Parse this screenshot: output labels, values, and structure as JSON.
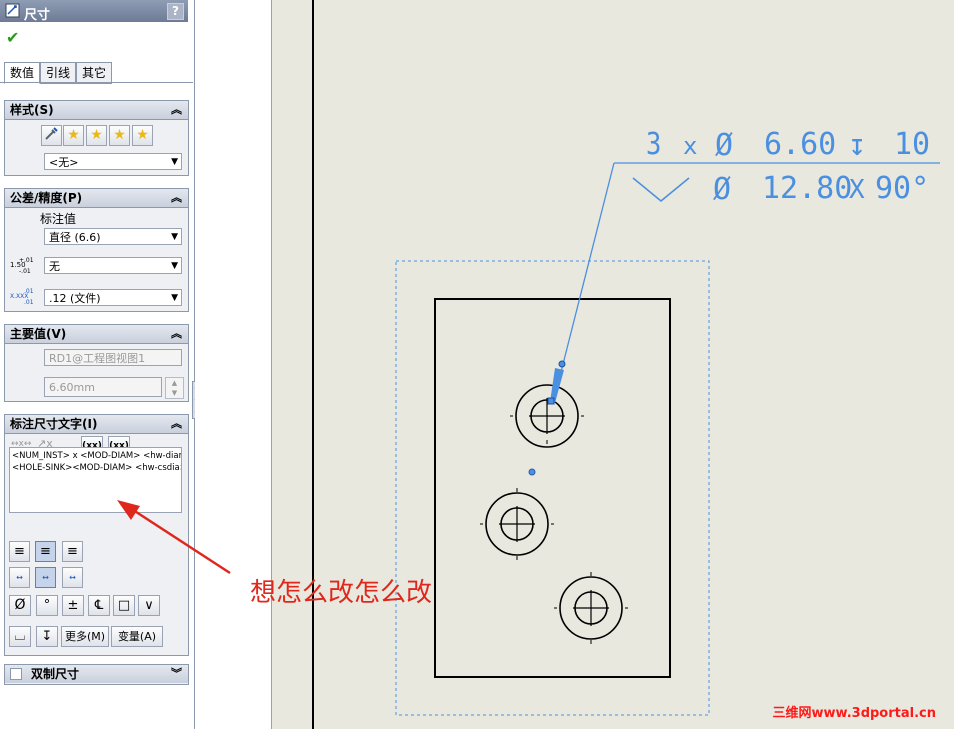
{
  "panel": {
    "title": "尺寸",
    "help": "?",
    "ok_icon": "checkmark-icon",
    "tabs": [
      "数值",
      "引线",
      "其它"
    ]
  },
  "style_group": {
    "header": "样式(S)",
    "combo_value": "<无>"
  },
  "tolerance_group": {
    "header": "公差/精度(P)",
    "label": "标注值",
    "combo1": "直径 (6.6)",
    "combo2": "无",
    "combo3": ".12 (文件)",
    "tol_icon_main": "1.50",
    "tol_icon_sup": "+.01",
    "tol_icon_sub": "-.01",
    "prec_icon_main": "X.XXX",
    "prec_icon_sup": ".01",
    "prec_icon_sub": ".01"
  },
  "primary_group": {
    "header": "主要值(V)",
    "ref_field": "RD1@工程图视图1",
    "value_field": "6.60mm"
  },
  "dimtext_group": {
    "header": "标注尺寸文字(I)",
    "paren_btn1": "(xx)",
    "paren_btn2": "(xx)",
    "line1": "<NUM_INST> x <MOD-DIAM> <hw-diam> <HOLE-DEPTH> <hw-depth>",
    "line2": "<HOLE-SINK><MOD-DIAM> <hw-csdia> X <hw-csangle>",
    "sym_diam": "Ø",
    "sym_deg": "°",
    "sym_pm": "±",
    "sym_cl": "℄",
    "sym_sq": "□",
    "sym_csk": "∨",
    "sym_cbore": "⌴",
    "sym_depth": "↧",
    "more_btn": "更多(M)",
    "var_btn": "变量(A)"
  },
  "dual_group": {
    "header": "双制尺寸"
  },
  "drawing": {
    "callout_line1": [
      "3",
      "x",
      "Ø",
      "6.60",
      "↧",
      "10"
    ],
    "callout_line2": [
      "⌵",
      "Ø",
      "12.80",
      "X",
      "90°"
    ],
    "callout_color": "#3d90e0"
  },
  "annotation": {
    "text": "想怎么改怎么改"
  },
  "watermark": "三维网www.3dportal.cn"
}
